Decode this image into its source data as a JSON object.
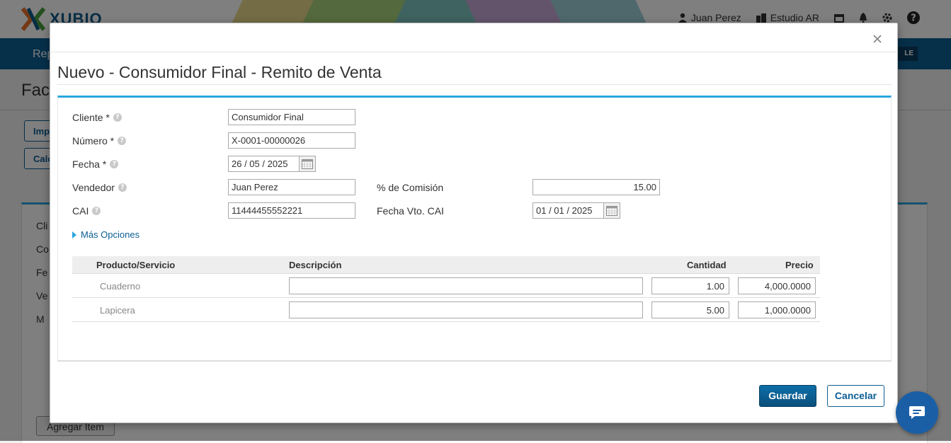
{
  "app": {
    "logo_text": "XUBIO",
    "user_name": "Juan Perez",
    "company": "Estudio AR",
    "nav_item": "Rep",
    "nav_tag": "LE",
    "page_title": "Fac",
    "bg_buttons": [
      "Imp",
      "Calc"
    ],
    "bg_labels": [
      "Cli",
      "Co",
      "Fe",
      "Ve",
      "M"
    ],
    "add_item_label": "Agregar Item"
  },
  "modal": {
    "title": "Nuevo - Consumidor Final - Remito de Venta",
    "fields": {
      "cliente": {
        "label": "Cliente *",
        "value": "Consumidor Final"
      },
      "numero": {
        "label": "Número *",
        "value": "X-0001-00000026"
      },
      "fecha": {
        "label": "Fecha *",
        "value": "26 / 05 /  2025"
      },
      "vendedor": {
        "label": "Vendedor",
        "value": "Juan Perez"
      },
      "comision": {
        "label": "% de Comisión",
        "value": "15.00"
      },
      "cai": {
        "label": "CAI",
        "value": "11444455552221"
      },
      "fecha_vto_cai": {
        "label": "Fecha Vto. CAI",
        "value": "01 / 01 /  2025"
      }
    },
    "more_options": "Más Opciones",
    "table": {
      "headers": [
        "Producto/Servicio",
        "Descripción",
        "Cantidad",
        "Precio"
      ],
      "rows": [
        {
          "producto": "Cuaderno",
          "descripcion": "",
          "cantidad": "1.00",
          "precio": "4,000.0000"
        },
        {
          "producto": "Lapicera",
          "descripcion": "",
          "cantidad": "5.00",
          "precio": "1,000.0000"
        }
      ]
    },
    "buttons": {
      "save": "Guardar",
      "cancel": "Cancelar"
    }
  },
  "colors": {
    "accent": "#2aa6df",
    "primary": "#0d5e93",
    "chat": "#1a5fa6"
  }
}
